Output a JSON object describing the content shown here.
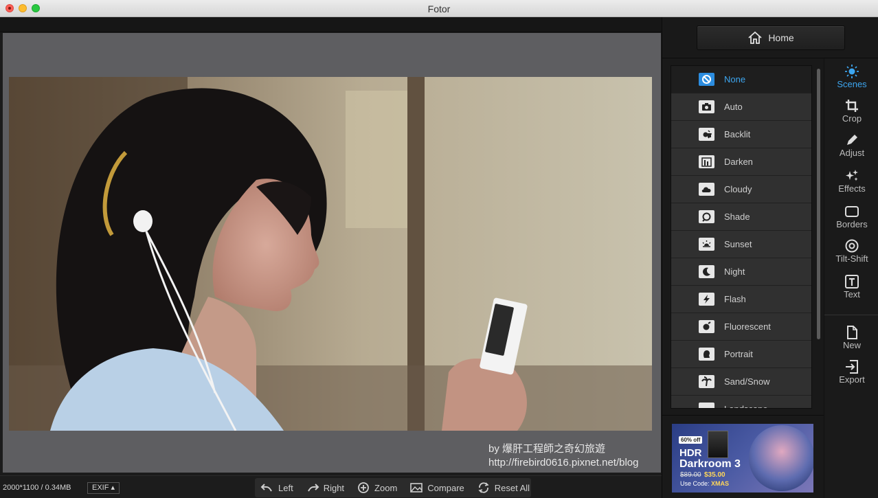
{
  "window": {
    "title": "Fotor"
  },
  "status": {
    "dimensions": "2000*1100 / 0.34MB",
    "exif_label": "EXIF ▴"
  },
  "bottom_tools": [
    {
      "label": "Left",
      "icon": "rotate-left-icon"
    },
    {
      "label": "Right",
      "icon": "rotate-right-icon"
    },
    {
      "label": "Zoom",
      "icon": "zoom-icon"
    },
    {
      "label": "Compare",
      "icon": "compare-icon"
    },
    {
      "label": "Reset All",
      "icon": "reset-icon"
    }
  ],
  "watermark": {
    "line1": "by 爆肝工程師之奇幻旅遊",
    "line2": "http://firebird0616.pixnet.net/blog"
  },
  "home": {
    "label": "Home"
  },
  "scenes": {
    "selected": "None",
    "items": [
      {
        "label": "None",
        "icon": "none-icon"
      },
      {
        "label": "Auto",
        "icon": "camera-icon"
      },
      {
        "label": "Backlit",
        "icon": "backlit-icon"
      },
      {
        "label": "Darken",
        "icon": "darken-icon"
      },
      {
        "label": "Cloudy",
        "icon": "cloud-icon"
      },
      {
        "label": "Shade",
        "icon": "shade-icon"
      },
      {
        "label": "Sunset",
        "icon": "sunset-icon"
      },
      {
        "label": "Night",
        "icon": "moon-icon"
      },
      {
        "label": "Flash",
        "icon": "flash-icon"
      },
      {
        "label": "Fluorescent",
        "icon": "bulb-icon"
      },
      {
        "label": "Portrait",
        "icon": "portrait-icon"
      },
      {
        "label": "Sand/Snow",
        "icon": "palm-icon"
      },
      {
        "label": "Landscape",
        "icon": "landscape-icon"
      }
    ]
  },
  "side_tools": [
    {
      "label": "Scenes",
      "icon": "sun-icon",
      "active": true
    },
    {
      "label": "Crop",
      "icon": "crop-icon"
    },
    {
      "label": "Adjust",
      "icon": "pencil-icon"
    },
    {
      "label": "Effects",
      "icon": "sparkle-icon"
    },
    {
      "label": "Borders",
      "icon": "border-icon"
    },
    {
      "label": "Tilt-Shift",
      "icon": "target-icon"
    },
    {
      "label": "Text",
      "icon": "text-icon"
    },
    {
      "label": "New",
      "icon": "new-file-icon"
    },
    {
      "label": "Export",
      "icon": "export-icon"
    }
  ],
  "ad": {
    "badge": "60% off",
    "line1": "HDR",
    "line2": "Darkroom 3",
    "old_price": "$89.00",
    "new_price": "$35.00",
    "code_label": "Use Code:",
    "code": "XMAS"
  },
  "colors": {
    "accent": "#3da6f0",
    "panel": "#2c2c2c",
    "canvas": "#5e5e61"
  }
}
